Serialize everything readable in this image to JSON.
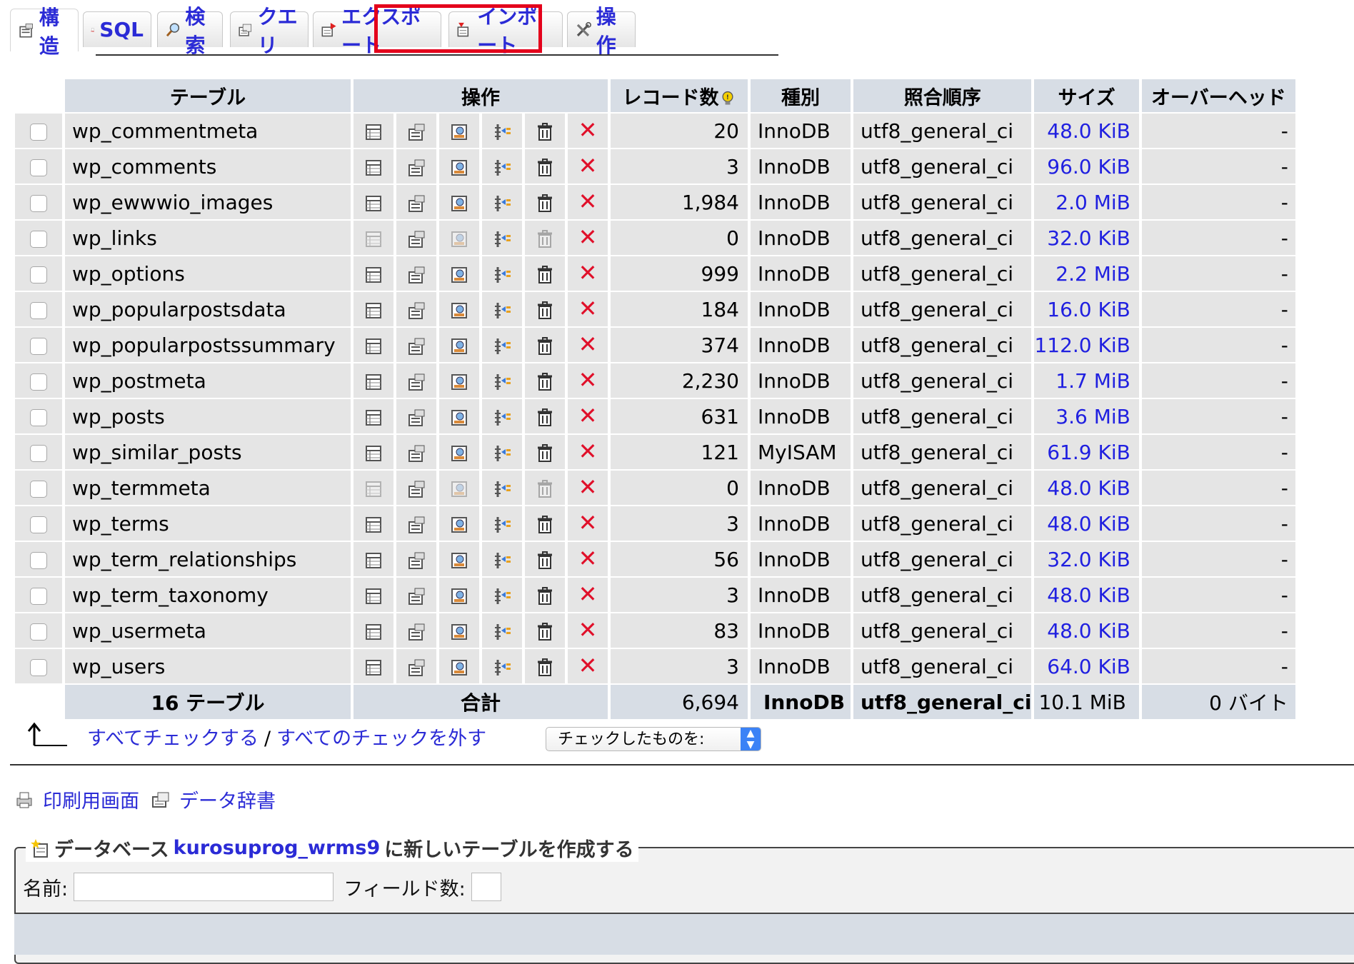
{
  "tabs": [
    {
      "label": "構造",
      "icon": "structure-icon",
      "active": true
    },
    {
      "label": "SQL",
      "icon": "sql-icon"
    },
    {
      "label": "検索",
      "icon": "search-icon"
    },
    {
      "label": "クエリ",
      "icon": "query-icon"
    },
    {
      "label": "エクスポート",
      "icon": "export-icon",
      "highlighted": true
    },
    {
      "label": "インポート",
      "icon": "import-icon"
    },
    {
      "label": "操作",
      "icon": "tools-icon"
    }
  ],
  "table": {
    "headers": {
      "table": "テーブル",
      "ops": "操作",
      "records": "レコード数",
      "engine": "種別",
      "collation": "照合順序",
      "size": "サイズ",
      "overhead": "オーバーヘッド"
    },
    "rows": [
      {
        "name": "wp_commentmeta",
        "records": "20",
        "engine": "InnoDB",
        "collation": "utf8_general_ci",
        "size": "48.0 KiB",
        "overhead": "-",
        "empty": false
      },
      {
        "name": "wp_comments",
        "records": "3",
        "engine": "InnoDB",
        "collation": "utf8_general_ci",
        "size": "96.0 KiB",
        "overhead": "-",
        "empty": false
      },
      {
        "name": "wp_ewwwio_images",
        "records": "1,984",
        "engine": "InnoDB",
        "collation": "utf8_general_ci",
        "size": "2.0 MiB",
        "overhead": "-",
        "empty": false
      },
      {
        "name": "wp_links",
        "records": "0",
        "engine": "InnoDB",
        "collation": "utf8_general_ci",
        "size": "32.0 KiB",
        "overhead": "-",
        "empty": true
      },
      {
        "name": "wp_options",
        "records": "999",
        "engine": "InnoDB",
        "collation": "utf8_general_ci",
        "size": "2.2 MiB",
        "overhead": "-",
        "empty": false
      },
      {
        "name": "wp_popularpostsdata",
        "records": "184",
        "engine": "InnoDB",
        "collation": "utf8_general_ci",
        "size": "16.0 KiB",
        "overhead": "-",
        "empty": false
      },
      {
        "name": "wp_popularpostssummary",
        "records": "374",
        "engine": "InnoDB",
        "collation": "utf8_general_ci",
        "size": "112.0 KiB",
        "overhead": "-",
        "empty": false
      },
      {
        "name": "wp_postmeta",
        "records": "2,230",
        "engine": "InnoDB",
        "collation": "utf8_general_ci",
        "size": "1.7 MiB",
        "overhead": "-",
        "empty": false
      },
      {
        "name": "wp_posts",
        "records": "631",
        "engine": "InnoDB",
        "collation": "utf8_general_ci",
        "size": "3.6 MiB",
        "overhead": "-",
        "empty": false
      },
      {
        "name": "wp_similar_posts",
        "records": "121",
        "engine": "MyISAM",
        "collation": "utf8_general_ci",
        "size": "61.9 KiB",
        "overhead": "-",
        "empty": false
      },
      {
        "name": "wp_termmeta",
        "records": "0",
        "engine": "InnoDB",
        "collation": "utf8_general_ci",
        "size": "48.0 KiB",
        "overhead": "-",
        "empty": true
      },
      {
        "name": "wp_terms",
        "records": "3",
        "engine": "InnoDB",
        "collation": "utf8_general_ci",
        "size": "48.0 KiB",
        "overhead": "-",
        "empty": false
      },
      {
        "name": "wp_term_relationships",
        "records": "56",
        "engine": "InnoDB",
        "collation": "utf8_general_ci",
        "size": "32.0 KiB",
        "overhead": "-",
        "empty": false
      },
      {
        "name": "wp_term_taxonomy",
        "records": "3",
        "engine": "InnoDB",
        "collation": "utf8_general_ci",
        "size": "48.0 KiB",
        "overhead": "-",
        "empty": false
      },
      {
        "name": "wp_usermeta",
        "records": "83",
        "engine": "InnoDB",
        "collation": "utf8_general_ci",
        "size": "48.0 KiB",
        "overhead": "-",
        "empty": false
      },
      {
        "name": "wp_users",
        "records": "3",
        "engine": "InnoDB",
        "collation": "utf8_general_ci",
        "size": "64.0 KiB",
        "overhead": "-",
        "empty": false
      }
    ],
    "footer": {
      "count": "16 テーブル",
      "total_label": "合計",
      "records": "6,694",
      "engine": "InnoDB",
      "collation": "utf8_general_ci",
      "size": "10.1 MiB",
      "overhead": "0 バイト"
    }
  },
  "bulk": {
    "check_all": "すべてチェックする",
    "separator": "/",
    "uncheck_all": "すべてのチェックを外す",
    "select_value": "チェックしたものを:"
  },
  "links": {
    "print": "印刷用画面",
    "dictionary": "データ辞書"
  },
  "create": {
    "prefix": "データベース",
    "database": "kurosuprog_wrms9",
    "suffix": "に新しいテーブルを作成する",
    "name_label": "名前:",
    "fields_label": "フィールド数:"
  },
  "colors": {
    "link": "#2b2bd6",
    "header_bg": "#d7dde5",
    "row_bg": "#e5e5e5",
    "highlight": "#e4001b",
    "drop": "#e0102a"
  }
}
